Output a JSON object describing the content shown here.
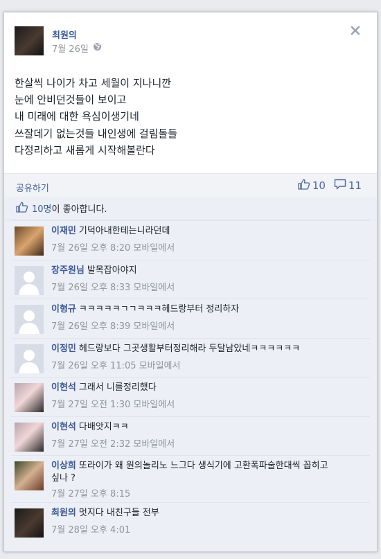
{
  "post": {
    "author": "최원의",
    "date": "7월 26일",
    "lines": [
      "한살씩 나이가 차고 세월이 지나니깐",
      "눈에 안비던것들이 보이고",
      "내 미래에 대한 욕심이생기네",
      "쓰잘데기 없는것들 내인생에 걸림돌들",
      "다정리하고 새롭게 시작해볼란다"
    ]
  },
  "actions": {
    "share": "공유하기",
    "like_count": "10",
    "comment_count": "11"
  },
  "likes": {
    "count": "10명",
    "text": "이 좋아합니다."
  },
  "comments": [
    {
      "name": "이재민",
      "text": "기덕아내한테는니라던데",
      "time": "7월 26일 오후 8:20 모바일에서",
      "avatar": "photo"
    },
    {
      "name": "장주원님",
      "text": "발목잡아야지",
      "time": "7월 26일 오후 8:33 모바일에서",
      "avatar": "default"
    },
    {
      "name": "이형규",
      "text": "ㅋㅋㅋㅋㅋㄱㄱㅋㅋㅋ헤드랑부터 정리하자",
      "time": "7월 26일 오후 8:39 모바일에서",
      "avatar": "default"
    },
    {
      "name": "이정민",
      "text": "헤드랑보다 그곳생활부터정리해라 두달남았네ㅋㅋㅋㅋㅋㅋ",
      "time": "7월 26일 오후 11:05 모바일에서",
      "avatar": "default"
    },
    {
      "name": "이현석",
      "text": "그래서 니를정리했다",
      "time": "7월 27일 오전 1:30 모바일에서",
      "avatar": "photo"
    },
    {
      "name": "이현석",
      "text": "다배앗지ㅋㅋ",
      "time": "7월 27일 오전 2:32 모바일에서",
      "avatar": "photo"
    },
    {
      "name": "이상희",
      "text": "또라이가 왜 원의놀리노 느그다 생식기에 고환폭파술한대씩 꼽히고 싶나 ?",
      "time": "7월 27일 오후 8:15",
      "avatar": "photo"
    },
    {
      "name": "최원의",
      "text": "멋지다 내친구들 전부",
      "time": "7월 28일 오후 4:01",
      "avatar": "photo"
    }
  ],
  "colors": {
    "link": "#3b5998",
    "meta": "#90949c",
    "feedback_bg": "#edeff4"
  },
  "icons": [
    "close-icon",
    "globe-icon",
    "thumbs-up-icon",
    "comment-icon"
  ]
}
